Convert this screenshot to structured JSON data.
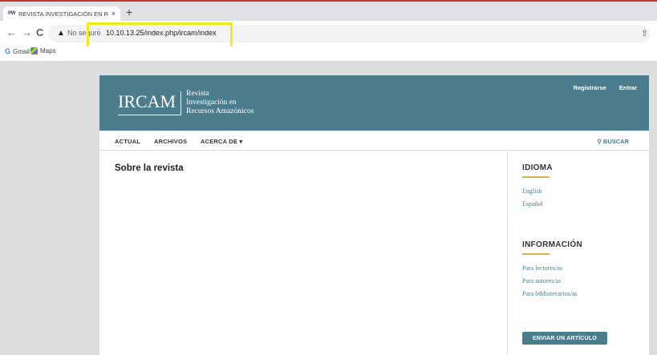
{
  "browser": {
    "tab": {
      "favicon": "PW",
      "title": "REVISTA INVESTIGACIÓN EN RE",
      "close": "×"
    },
    "new_tab": "+",
    "nav": {
      "back": "←",
      "forward": "→",
      "reload": "C"
    },
    "address_bar": {
      "security_label": "No seguro",
      "separator": "|",
      "url": "10.10.13.25/index.php/ircam/index"
    },
    "bookmarks": [
      {
        "label": "Gmail",
        "icon": "gmail-icon"
      },
      {
        "label": "Maps",
        "icon": "maps-icon"
      }
    ],
    "highlight_color": "#f0ea1a"
  },
  "site": {
    "header": {
      "logo_main": "IRCAM",
      "logo_sub_lines": [
        "Revista",
        "Investigación en",
        "Recursos Amazónicos"
      ],
      "register": "Registrarse",
      "login": "Entrar",
      "bg_color": "#4b7d8d"
    },
    "nav": {
      "items": [
        "ACTUAL",
        "ARCHIVOS",
        "ACERCA DE ▾"
      ],
      "search": "BUSCAR"
    },
    "main": {
      "title": "Sobre la revista"
    },
    "sidebar": {
      "language_title": "IDIOMA",
      "languages": [
        "English",
        "Español"
      ],
      "info_title": "INFORMACIÓN",
      "info_links": [
        "Para lectores/as",
        "Para autores/as",
        "Para bibliotecarios/as"
      ],
      "submit_button": "ENVIAR UN ARTÍCULO",
      "accent_color": "#ddb14a"
    }
  }
}
